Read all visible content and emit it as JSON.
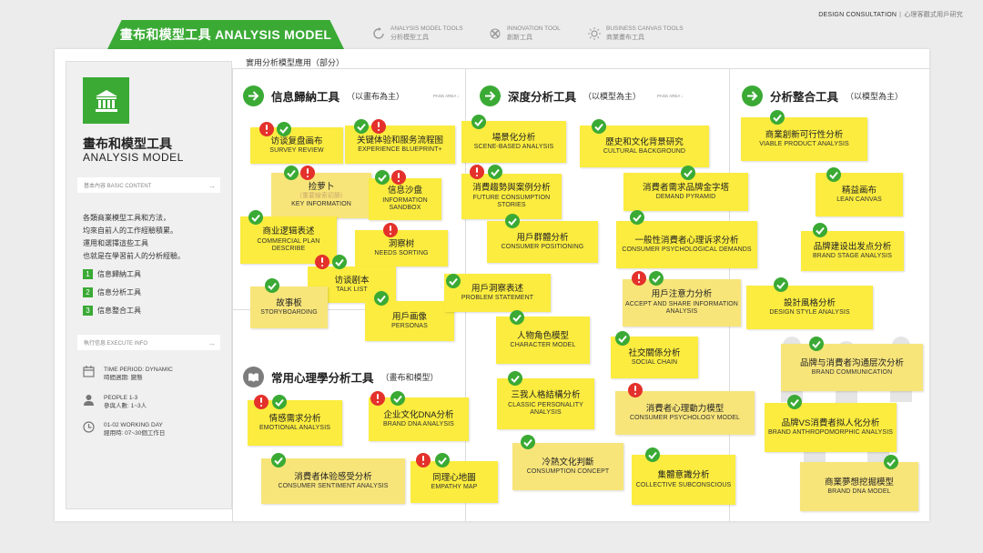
{
  "header": {
    "main_tab": "畫布和模型工具 ANALYSIS MODEL",
    "tool_tabs": [
      {
        "en": "ANALYSIS MODEL TOOLS",
        "cn": "分析模型工具",
        "icon": "refresh-icon"
      },
      {
        "en": "INNOVATION TOOL",
        "cn": "創新工具",
        "icon": "knot-icon"
      },
      {
        "en": "BUSINESS CANVAS TOOLS",
        "cn": "商業畫布工具",
        "icon": "sun-icon"
      }
    ],
    "brand": "DESIGN CONSULTATION",
    "brand_sub": "心理客觀式用戶研究"
  },
  "sidebar": {
    "title_cn": "畫布和模型工具",
    "title_en": "ANALYSIS MODEL",
    "basic_bar": "基本內容 BASIC CONTENT",
    "desc": [
      "各類商業模型工具和方法，",
      "均來自前人的工作經驗積累。",
      "運用和選擇這些工具",
      "也就是在學習前人的分析經驗。"
    ],
    "items": [
      {
        "num": "1",
        "label": "信息歸納工具"
      },
      {
        "num": "2",
        "label": "信息分析工具"
      },
      {
        "num": "3",
        "label": "信息整合工具"
      }
    ],
    "execute_bar": "執行信息 EXECUTE INFO",
    "info": [
      {
        "icon": "calendar-icon",
        "line1": "TIME PERIOD: DYNAMIC",
        "line2": "時間週期: 變態"
      },
      {
        "icon": "person-icon",
        "line1": "PEOPLE 1-3",
        "line2": "參與人數: 1~3人"
      },
      {
        "icon": "clock-icon",
        "line1": "01-02 WORKING DAY",
        "line2": "經用時: 07~30個工作日"
      }
    ],
    "arrow": "→"
  },
  "area_top_label": "實用分析模型應用（部分）",
  "sections": [
    {
      "title": "信息歸納工具",
      "subtitle": "（以畫布為主）",
      "page": "PAGE AREA ↓"
    },
    {
      "title": "深度分析工具",
      "subtitle": "（以模型為主）",
      "page": "PAGE AREA ↓"
    },
    {
      "title": "分析整合工具",
      "subtitle": "（以模型為主）",
      "page": ""
    },
    {
      "title": "常用心理學分析工具",
      "subtitle": "（畫布和模型）",
      "page": ""
    }
  ],
  "notes": [
    {
      "cn": "访谈复盘画布",
      "en": "SURVEY REVIEW",
      "sub": "",
      "badges": [
        "warn",
        "ok"
      ]
    },
    {
      "cn": "关键体验和服务流程图",
      "en": "EXPERIENCE BLUEPRINT+",
      "sub": "",
      "badges": [
        "ok",
        "warn"
      ]
    },
    {
      "cn": "捡萝卜",
      "en": "KEY INFORMATION",
      "sub": "（重要線索初篩）",
      "badges": [
        "ok",
        "warn"
      ]
    },
    {
      "cn": "信息沙盘",
      "en": "INFORMATION SANDBOX",
      "sub": "",
      "badges": [
        "ok",
        "warn"
      ]
    },
    {
      "cn": "商业逻辑表述",
      "en": "COMMERCIAL PLAN DESCRIBE",
      "sub": "",
      "badges": [
        "ok"
      ]
    },
    {
      "cn": "洞察树",
      "en": "NEEDS SORTING",
      "sub": "",
      "badges": [
        "warn"
      ]
    },
    {
      "cn": "访谈剧本",
      "en": "TALK LIST",
      "sub": "",
      "badges": [
        "warn",
        "ok"
      ]
    },
    {
      "cn": "故事板",
      "en": "STORYBOARDING",
      "sub": "",
      "badges": [
        "ok"
      ]
    },
    {
      "cn": "用戶画像",
      "en": "PERSONAS",
      "sub": "",
      "badges": [
        "ok"
      ]
    },
    {
      "cn": "場景化分析",
      "en": "SCENE-BASED ANALYSIS",
      "sub": "",
      "badges": [
        "ok"
      ]
    },
    {
      "cn": "歷史和文化背景研究",
      "en": "CULTURAL BACKGROUND",
      "sub": "",
      "badges": [
        "ok"
      ]
    },
    {
      "cn": "消費趨勢與案例分析",
      "en": "FUTURE CONSUMPTION STORIES",
      "sub": "",
      "badges": [
        "warn",
        "ok"
      ]
    },
    {
      "cn": "消費者需求品牌金字塔",
      "en": "DEMAND PYRAMID",
      "sub": "",
      "badges": [
        "ok"
      ]
    },
    {
      "cn": "用戶群體分析",
      "en": "CONSUMER POSITIONING",
      "sub": "",
      "badges": [
        "ok"
      ]
    },
    {
      "cn": "一般性消費者心理诉求分析",
      "en": "CONSUMER PSYCHOLOGICAL DEMANDS",
      "sub": "",
      "badges": [
        "ok"
      ]
    },
    {
      "cn": "用戶洞察表述",
      "en": "PROBLEM STATEMENT",
      "sub": "",
      "badges": [
        "ok"
      ]
    },
    {
      "cn": "用戶注意力分析",
      "en": "ACCEPT AND SHARE INFORMATION ANALYSIS",
      "sub": "",
      "badges": [
        "warn",
        "ok"
      ]
    },
    {
      "cn": "人物角色模型",
      "en": "CHARACTER MODEL",
      "sub": "",
      "badges": [
        "ok"
      ]
    },
    {
      "cn": "社交關係分析",
      "en": "SOCIAL CHAIN",
      "sub": "",
      "badges": [
        "ok"
      ]
    },
    {
      "cn": "三我人格結構分析",
      "en": "CLASSIC PERSONALITY ANALYSIS",
      "sub": "",
      "badges": [
        "ok"
      ]
    },
    {
      "cn": "消費者心理動力模型",
      "en": "CONSUMER PSYCHOLOGY MODEL",
      "sub": "",
      "badges": [
        "warn",
        "ok"
      ]
    },
    {
      "cn": "冷熱文化判斷",
      "en": "CONSUMPTION CONCEPT",
      "sub": "",
      "badges": [
        "ok"
      ]
    },
    {
      "cn": "集體意識分析",
      "en": "COLLECTIVE SUBCONSCIOUS",
      "sub": "",
      "badges": [
        "ok"
      ]
    },
    {
      "cn": "商業創新可行性分析",
      "en": "VIABLE PRODUCT ANALYSIS",
      "sub": "",
      "badges": [
        "ok"
      ]
    },
    {
      "cn": "精益画布",
      "en": "LEAN CANVAS",
      "sub": "",
      "badges": [
        "ok"
      ]
    },
    {
      "cn": "品牌建设出发点分析",
      "en": "BRAND STAGE ANALYSIS",
      "sub": "",
      "badges": [
        "ok"
      ]
    },
    {
      "cn": "設計風格分析",
      "en": "DESIGN STYLE ANALYSIS",
      "sub": "",
      "badges": [
        "ok"
      ]
    },
    {
      "cn": "品牌与消費者沟通层次分析",
      "en": "BRAND COMMUNICATION",
      "sub": "",
      "badges": [
        "ok"
      ]
    },
    {
      "cn": "品牌VS消費者拟人化分析",
      "en": "BRAND ANTHROPOMORPHIC ANALYSIS",
      "sub": "",
      "badges": [
        "ok"
      ]
    },
    {
      "cn": "商業夢想挖掘模型",
      "en": "BRAND DNA MODEL",
      "sub": "",
      "badges": [
        "ok"
      ]
    },
    {
      "cn": "情感需求分析",
      "en": "EMOTIONAL ANALYSIS",
      "sub": "",
      "badges": [
        "warn",
        "ok"
      ]
    },
    {
      "cn": "企业文化DNA分析",
      "en": "BRAND DNA ANALYSIS",
      "sub": "",
      "badges": [
        "warn",
        "ok"
      ]
    },
    {
      "cn": "消費者体验感受分析",
      "en": "CONSUMER SENTIMENT ANALYSIS",
      "sub": "",
      "badges": [
        "ok"
      ]
    },
    {
      "cn": "同理心地圖",
      "en": "EMPATHY MAP",
      "sub": "",
      "badges": [
        "warn",
        "ok"
      ]
    }
  ],
  "colors": {
    "accent": "#3aaa35",
    "note": "#fbec3f",
    "warn": "#e4312b"
  }
}
